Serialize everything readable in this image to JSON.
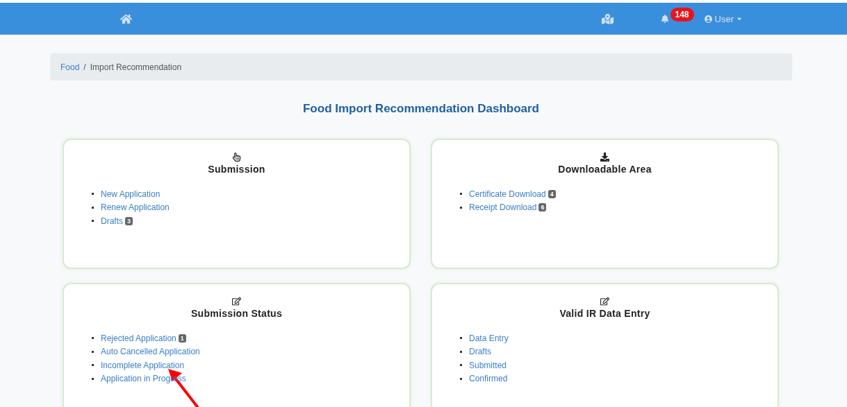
{
  "navbar": {
    "notification_count": "148",
    "user": "User"
  },
  "breadcrumb": {
    "separator": "/",
    "items": [
      {
        "label": "Food",
        "link": true
      },
      {
        "label": "Import Recommendation",
        "link": false
      }
    ]
  },
  "title": "Food Import Recommendation Dashboard",
  "cards": [
    {
      "title": "Submission",
      "items": [
        {
          "label": "New Application"
        },
        {
          "label": "Renew Application"
        },
        {
          "label": "Drafts",
          "badge": "3"
        }
      ]
    },
    {
      "title": "Downloadable Area",
      "items": [
        {
          "label": "Certificate Download",
          "badge": "4"
        },
        {
          "label": "Receipt Download",
          "badge": "6"
        }
      ]
    },
    {
      "title": "Submission Status",
      "items": [
        {
          "label": "Rejected Application",
          "badge": "1"
        },
        {
          "label": "Auto Cancelled Application"
        },
        {
          "label": "Incomplete Application"
        },
        {
          "label": "Application in Progress"
        }
      ]
    },
    {
      "title": "Valid IR Data Entry",
      "items": [
        {
          "label": "Data Entry"
        },
        {
          "label": "Drafts"
        },
        {
          "label": "Submitted"
        },
        {
          "label": "Confirmed"
        }
      ]
    }
  ]
}
